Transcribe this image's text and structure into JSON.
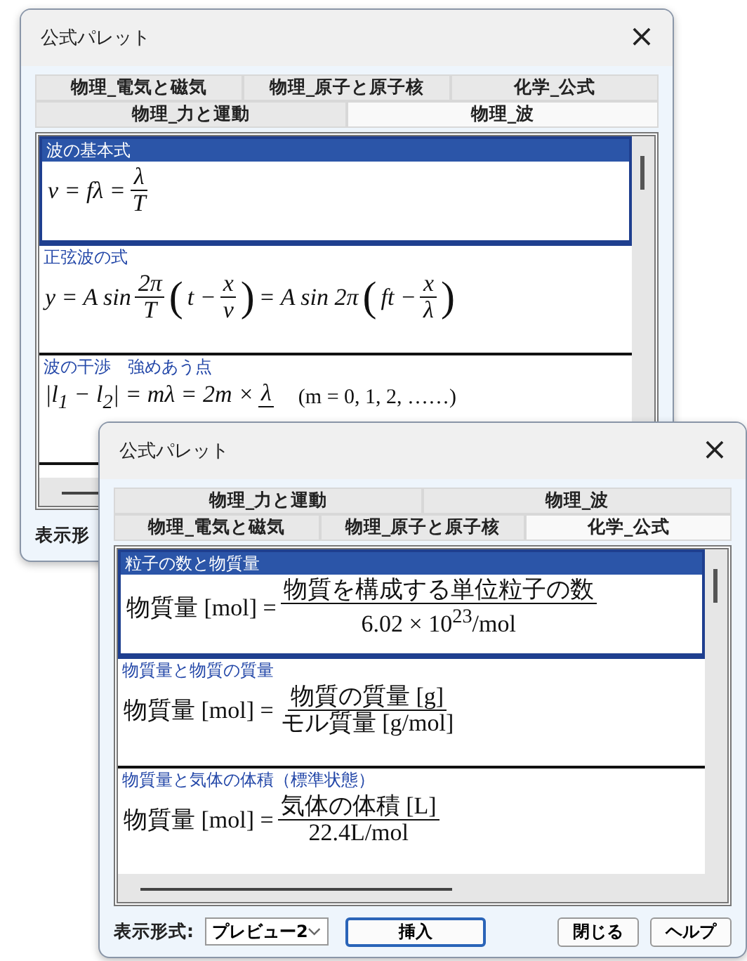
{
  "windows": [
    {
      "title": "公式パレット",
      "close": "×",
      "tab_rows": [
        [
          {
            "label": "物理_電気と磁気",
            "selected": false
          },
          {
            "label": "物理_原子と原子核",
            "selected": false
          },
          {
            "label": "化学_公式",
            "selected": false
          }
        ],
        [
          {
            "label": "物理_力と運動",
            "selected": false
          },
          {
            "label": "物理_波",
            "selected": true
          }
        ]
      ],
      "items": [
        {
          "title": "波の基本式",
          "selected": true,
          "formula": [
            {
              "kind": "math",
              "text": "v = fλ ="
            },
            {
              "kind": "frac",
              "num": "λ",
              "den": "T"
            }
          ]
        },
        {
          "title": "正弦波の式",
          "selected": false,
          "formula": [
            {
              "kind": "math",
              "text": "y = A sin"
            },
            {
              "kind": "frac",
              "num": "2π",
              "den": "T"
            },
            {
              "kind": "paren",
              "text": "("
            },
            {
              "kind": "math",
              "text": "t −"
            },
            {
              "kind": "frac",
              "num": "x",
              "den": "v"
            },
            {
              "kind": "paren",
              "text": ")"
            },
            {
              "kind": "math",
              "text": "= A sin 2π"
            },
            {
              "kind": "paren",
              "text": "("
            },
            {
              "kind": "math",
              "text": "ft −"
            },
            {
              "kind": "frac",
              "num": "x",
              "den": "λ"
            },
            {
              "kind": "paren",
              "text": ")"
            }
          ]
        },
        {
          "title": "波の干渉　強めあう点",
          "selected": false,
          "formula": [
            {
              "kind": "math",
              "text": "|l$_{1}$ − l$_{2}$| = mλ = 2m ×"
            },
            {
              "kind": "frac",
              "num": "λ"
            },
            {
              "kind": "note",
              "text": "(m = 0, 1, 2, ……)"
            }
          ]
        }
      ],
      "footer_label": "表示形"
    },
    {
      "title": "公式パレット",
      "close": "×",
      "tab_rows": [
        [
          {
            "label": "物理_力と運動",
            "selected": false
          },
          {
            "label": "物理_波",
            "selected": false
          }
        ],
        [
          {
            "label": "物理_電気と磁気",
            "selected": false
          },
          {
            "label": "物理_原子と原子核",
            "selected": false
          },
          {
            "label": "化学_公式",
            "selected": true
          }
        ]
      ],
      "items": [
        {
          "title": "粒子の数と物質量",
          "selected": true,
          "formula": [
            {
              "kind": "text",
              "text": "物質量 [mol] ="
            },
            {
              "kind": "frac",
              "num": "物質を構成する単位粒子の数",
              "den": "6.02 × 10$^{23}$/mol"
            }
          ]
        },
        {
          "title": "物質量と物質の質量",
          "selected": false,
          "formula": [
            {
              "kind": "text",
              "text": "物質量 [mol] ="
            },
            {
              "kind": "frac",
              "num": "物質の質量 [g]",
              "den": "モル質量 [g/mol]"
            }
          ]
        },
        {
          "title": "物質量と気体の体積（標準状態）",
          "selected": false,
          "formula": [
            {
              "kind": "text",
              "text": "物質量 [mol] ="
            },
            {
              "kind": "frac",
              "num": "気体の体積 [L]",
              "den": "22.4L/mol"
            }
          ]
        }
      ],
      "footer_label": "表示形式:",
      "dropdown": {
        "value": "プレビュー2"
      },
      "buttons": [
        {
          "label": "挿入",
          "default": true
        },
        {
          "label": "閉じる",
          "default": false
        },
        {
          "label": "ヘルプ",
          "default": false
        }
      ]
    }
  ]
}
